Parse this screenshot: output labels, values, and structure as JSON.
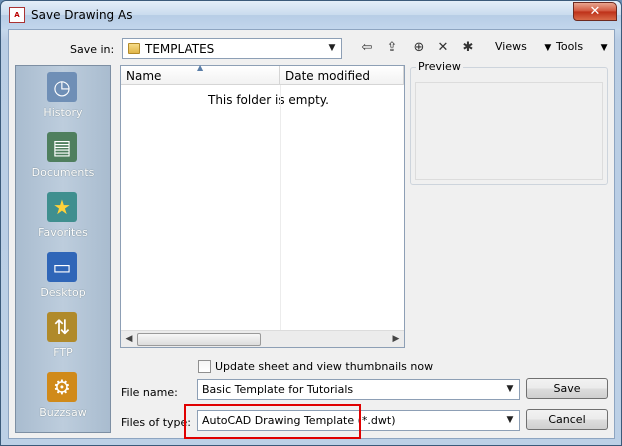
{
  "window": {
    "title": "Save Drawing As",
    "icon": "autocad-app-icon",
    "close_label": "✕"
  },
  "toolbar": {
    "save_in_label": "Save in:",
    "save_in_value": "TEMPLATES",
    "views_label": "Views",
    "tools_label": "Tools",
    "icons": [
      "back-icon",
      "up-folder-icon",
      "search-web-icon",
      "delete-icon",
      "new-folder-icon"
    ]
  },
  "places": [
    {
      "label": "History",
      "icon": "history-icon",
      "color": "#6f8fb6"
    },
    {
      "label": "Documents",
      "icon": "documents-icon",
      "color": "#4f7f5e"
    },
    {
      "label": "Favorites",
      "icon": "favorites-icon",
      "color": "#3f8f8f"
    },
    {
      "label": "Desktop",
      "icon": "desktop-icon",
      "color": "#2f66b8"
    },
    {
      "label": "FTP",
      "icon": "ftp-icon",
      "color": "#b08a2a"
    },
    {
      "label": "Buzzsaw",
      "icon": "buzzsaw-icon",
      "color": "#d08a1a"
    }
  ],
  "filelist": {
    "columns": [
      "Name",
      "Date modified"
    ],
    "empty_message": "This folder is empty."
  },
  "preview": {
    "label": "Preview"
  },
  "options": {
    "thumbnails_label": "Update sheet and view thumbnails now",
    "thumbnails_checked": false
  },
  "form": {
    "file_name_label": "File name:",
    "file_name_value": "Basic Template for Tutorials",
    "file_type_label": "Files of type:",
    "file_type_value": "AutoCAD Drawing Template (*.dwt)"
  },
  "buttons": {
    "save": "Save",
    "cancel": "Cancel"
  },
  "colors": {
    "highlight": "#e00000",
    "titlebar": "#c2d6ec",
    "close": "#c23a1f"
  }
}
